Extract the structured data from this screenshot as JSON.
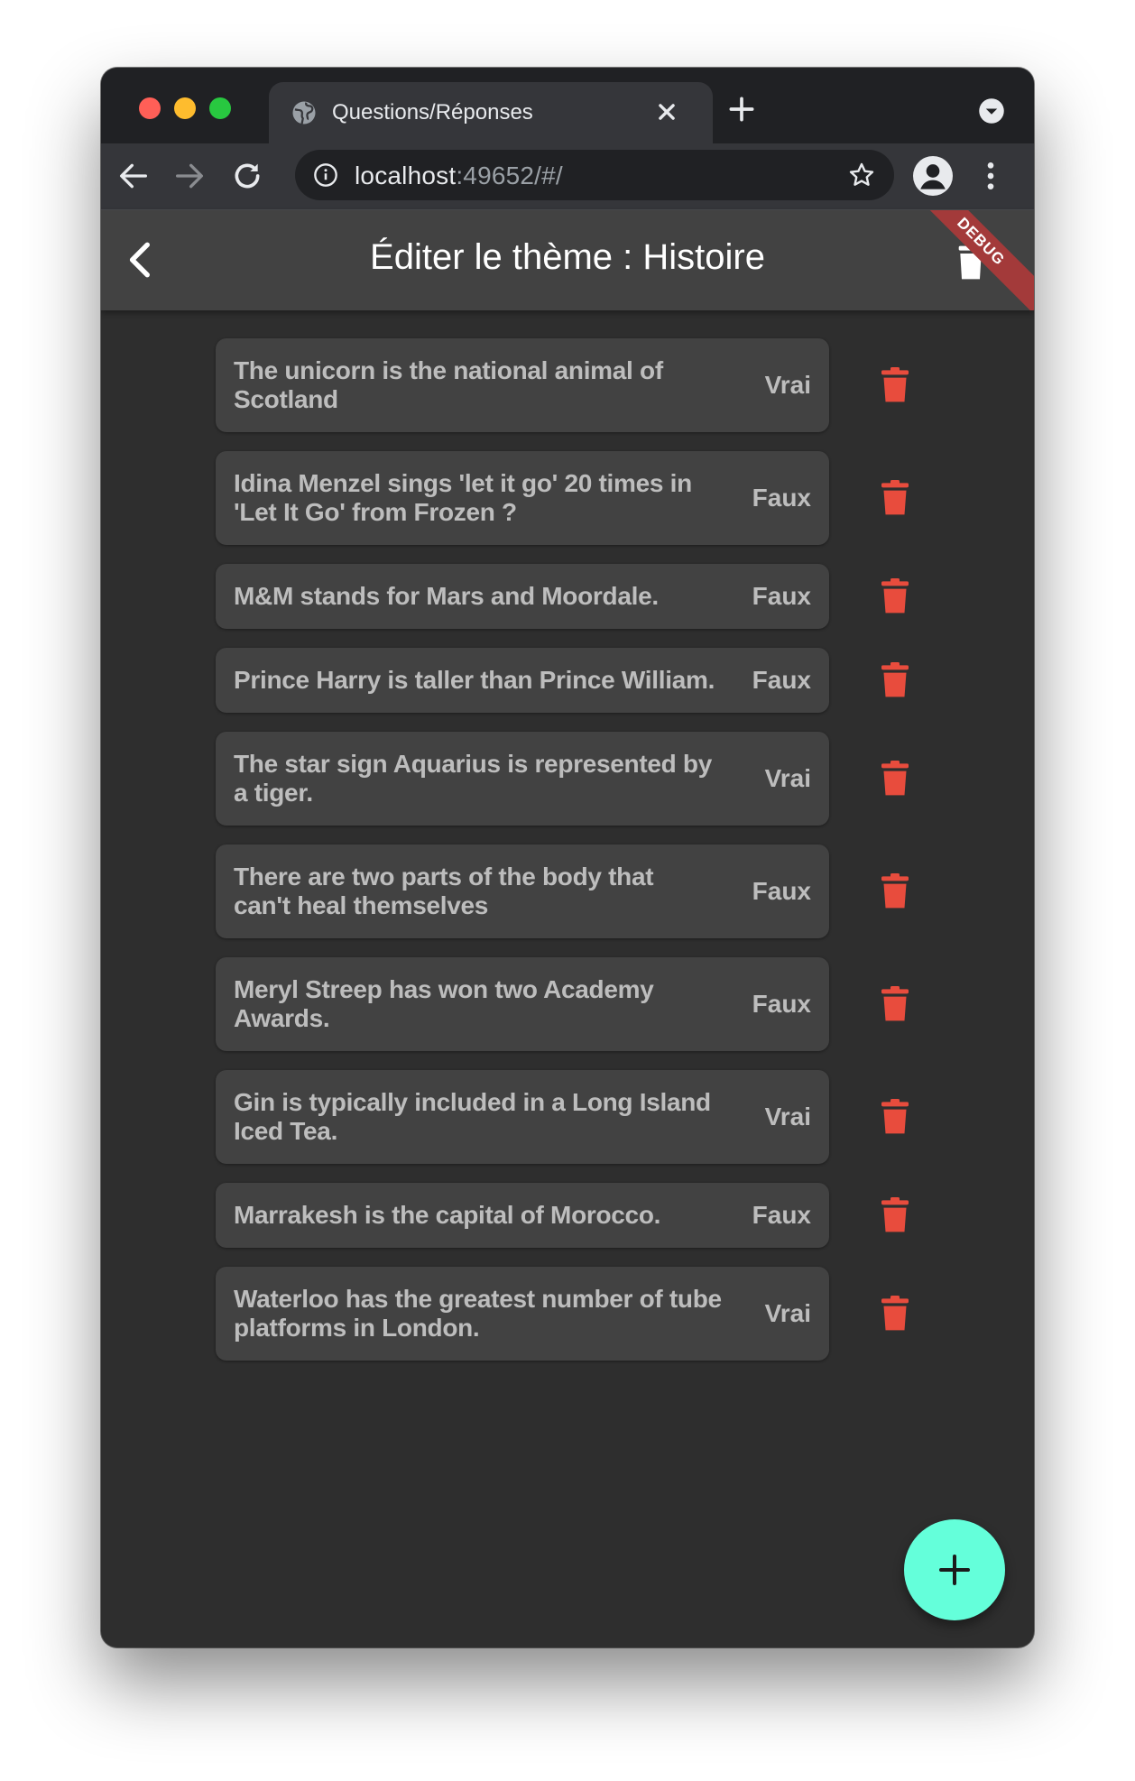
{
  "browser": {
    "tab_title": "Questions/Réponses",
    "url_host": "localhost",
    "url_rest": ":49652/#/"
  },
  "appbar": {
    "title": "Éditer le thème : Histoire",
    "debug_banner": "DEBUG"
  },
  "questions": [
    {
      "text": "The unicorn is the national animal of Scotland",
      "answer": "Vrai"
    },
    {
      "text": "Idina Menzel sings 'let it go' 20 times in 'Let It Go' from Frozen ?",
      "answer": "Faux"
    },
    {
      "text": "M&M stands for Mars and Moordale.",
      "answer": "Faux"
    },
    {
      "text": "Prince Harry is taller than Prince William.",
      "answer": "Faux"
    },
    {
      "text": "The star sign Aquarius is represented by a tiger.",
      "answer": "Vrai"
    },
    {
      "text": "There are two parts of the body that can't heal themselves",
      "answer": "Faux"
    },
    {
      "text": "Meryl Streep has won two Academy Awards.",
      "answer": "Faux"
    },
    {
      "text": "Gin is typically included in a Long Island Iced Tea.",
      "answer": "Vrai"
    },
    {
      "text": "Marrakesh is the capital of Morocco.",
      "answer": "Faux"
    },
    {
      "text": "Waterloo has the greatest number of tube platforms in London.",
      "answer": "Vrai"
    }
  ],
  "colors": {
    "delete": "#e84c3d",
    "fab": "#64ffda",
    "card": "#424242",
    "background": "#2e2e2e"
  },
  "icons": {
    "delete": "trash-icon",
    "fab": "plus-icon",
    "back": "arrow-back-icon"
  }
}
